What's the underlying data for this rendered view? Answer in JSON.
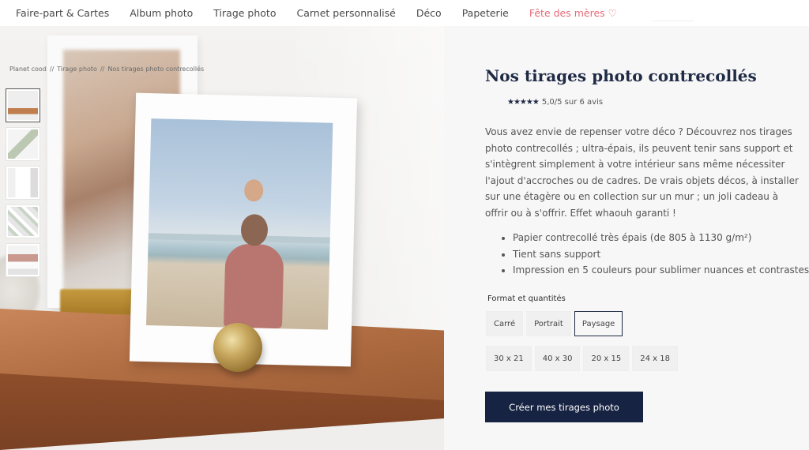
{
  "nav": {
    "items": [
      {
        "label": "Faire-part & Cartes"
      },
      {
        "label": "Album photo"
      },
      {
        "label": "Tirage photo"
      },
      {
        "label": "Carnet personnalisé"
      },
      {
        "label": "Déco"
      },
      {
        "label": "Papeterie"
      },
      {
        "label": "Fête des mères ♡"
      }
    ],
    "accent_color": "#e46b78"
  },
  "breadcrumb": [
    "Planet cood",
    "//",
    "Tirage photo",
    "//",
    "Nos tirages photo contrecollés"
  ],
  "gallery": {
    "thumbnails": [
      "thumb-1",
      "thumb-2",
      "thumb-3",
      "thumb-4",
      "thumb-5"
    ],
    "selected_index": 0
  },
  "product": {
    "title": "Nos tirages photo contrecollés",
    "stars": "★★★★★",
    "rating_text": "5,0/5 sur 6 avis",
    "description": "Vous avez envie de repenser votre déco ? Découvrez nos tirages photo contrecollés ; ultra-épais, ils peuvent tenir sans support et s'intègrent simplement à votre intérieur sans même nécessiter l'ajout d'accroches ou de cadres. De vrais objets décos, à installer sur une étagère ou en collection sur un mur ; un joli cadeau à offrir ou à s'offrir. Effet whaouh garanti !",
    "bullets": [
      "Papier contrecollé très épais (de 805 à 1130 g/m²)",
      "Tient sans support",
      "Impression en 5 couleurs pour sublimer nuances et contrastes"
    ],
    "format_label": "Format et quantités",
    "orientations": [
      "Carré",
      "Portrait",
      "Paysage"
    ],
    "selected_orientation": "Paysage",
    "sizes": [
      "30 x 21",
      "40 x 30",
      "20 x 15",
      "24 x 18"
    ],
    "cta_label": "Créer mes tirages photo",
    "brand_color": "#172342"
  }
}
